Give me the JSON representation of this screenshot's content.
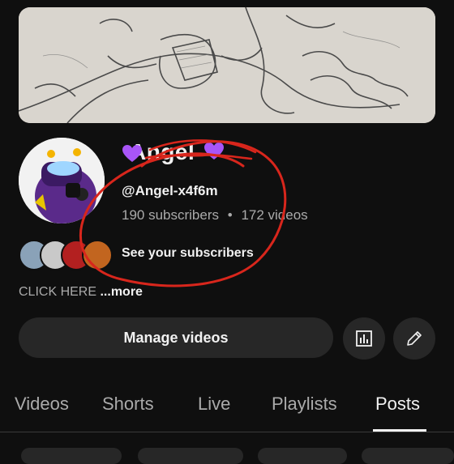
{
  "channel": {
    "name": "Angel",
    "handle": "@Angel-x4f6m",
    "subscribers": "190 subscribers",
    "separator": "•",
    "videos": "172 videos",
    "see_subscribers": "See your subscribers",
    "description": "CLICK HERE",
    "more": "...more"
  },
  "actions": {
    "manage_videos": "Manage videos",
    "analytics_icon": "analytics-icon",
    "edit_icon": "pencil-icon"
  },
  "tabs": [
    {
      "label": "Videos",
      "active": false
    },
    {
      "label": "Shorts",
      "active": false
    },
    {
      "label": "Live",
      "active": false
    },
    {
      "label": "Playlists",
      "active": false
    },
    {
      "label": "Posts",
      "active": true
    }
  ],
  "colors": {
    "background": "#0f0f0f",
    "button": "#272727",
    "text": "#f1f1f1",
    "secondary_text": "#aaaaaa",
    "heart": "#9b4dff",
    "annotation": "#d8261c"
  }
}
